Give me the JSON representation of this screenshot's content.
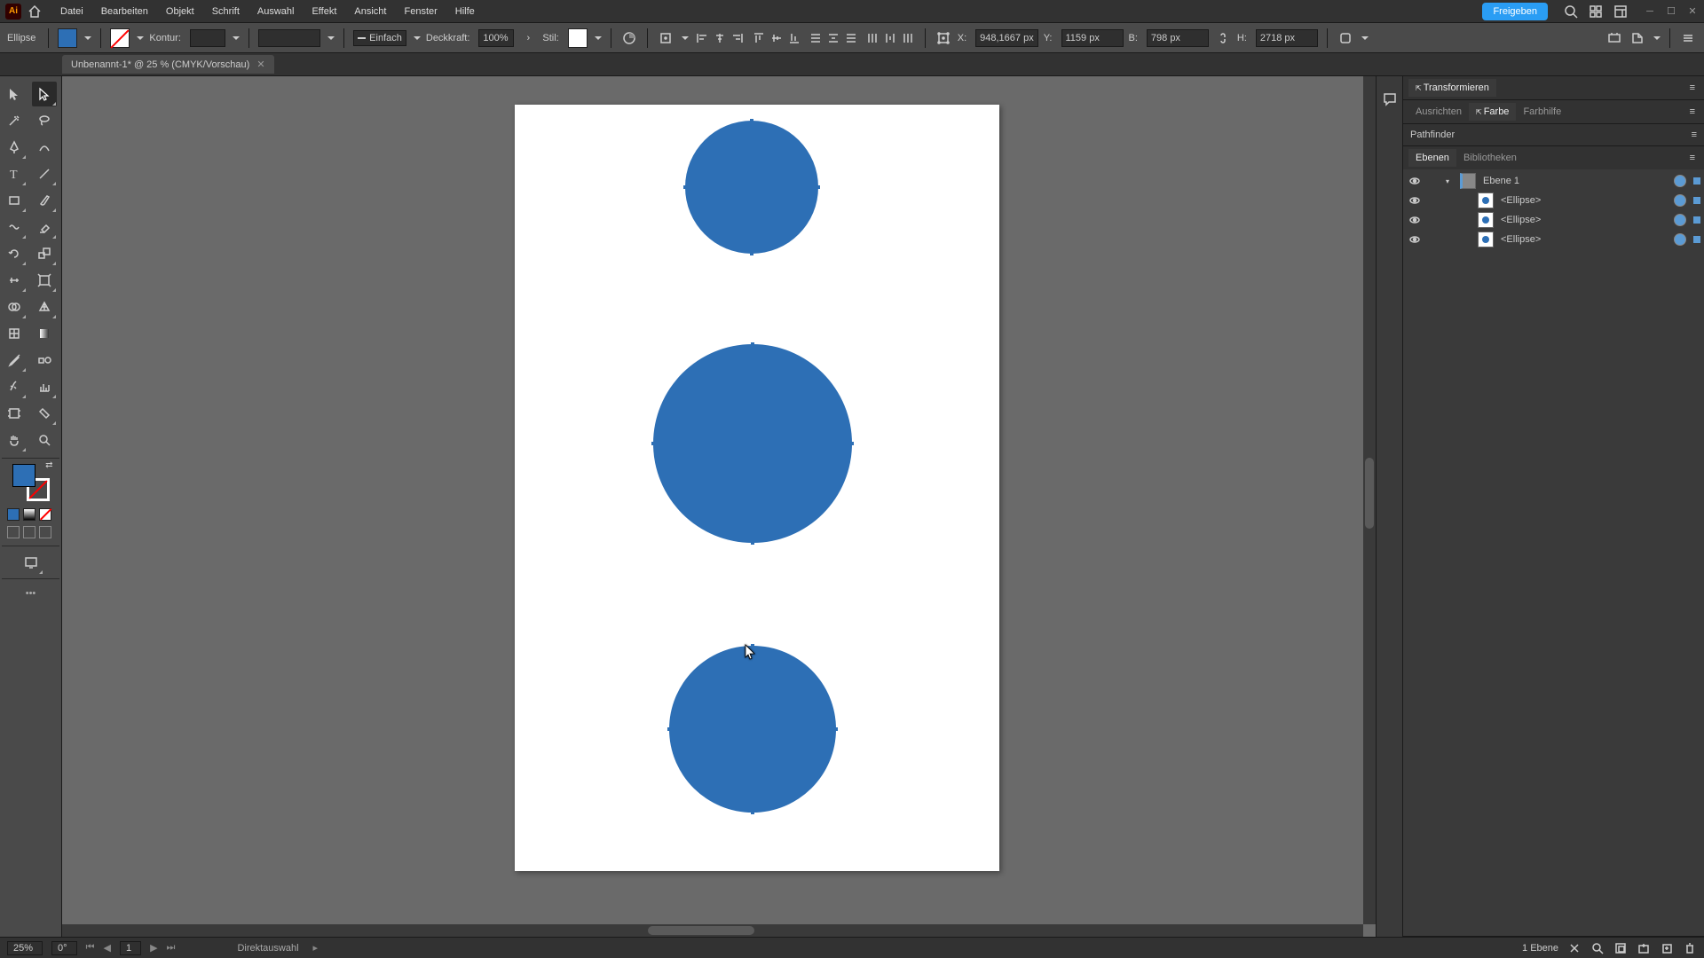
{
  "menubar": {
    "app_label": "Ai",
    "items": [
      "Datei",
      "Bearbeiten",
      "Objekt",
      "Schrift",
      "Auswahl",
      "Effekt",
      "Ansicht",
      "Fenster",
      "Hilfe"
    ],
    "share": "Freigeben"
  },
  "controlbar": {
    "object_type": "Ellipse",
    "kontur_label": "Kontur:",
    "kontur_value": "",
    "stroke_style": "Einfach",
    "opacity_label": "Deckkraft:",
    "opacity_value": "100%",
    "stil_label": "Stil:",
    "x_label": "X:",
    "x_value": "948,1667 px",
    "y_label": "Y:",
    "y_value": "1159 px",
    "w_label": "B:",
    "w_value": "798 px",
    "h_label": "H:",
    "h_value": "2718 px"
  },
  "tab": {
    "title": "Unbenannt-1* @ 25 % (CMYK/Vorschau)"
  },
  "panels": {
    "transform": "Transformieren",
    "ausrichten": "Ausrichten",
    "farbe": "Farbe",
    "farbhilfe": "Farbhilfe",
    "pathfinder": "Pathfinder",
    "ebenen": "Ebenen",
    "bibliotheken": "Bibliotheken"
  },
  "layers": {
    "parent": "Ebene 1",
    "children": [
      "<Ellipse>",
      "<Ellipse>",
      "<Ellipse>"
    ]
  },
  "statusbar": {
    "zoom": "25%",
    "rotation": "0°",
    "artboard_num": "1",
    "tool": "Direktauswahl",
    "layer_count": "1 Ebene"
  },
  "colors": {
    "shape_fill": "#2d6fb5",
    "accent": "#2a9df4"
  }
}
